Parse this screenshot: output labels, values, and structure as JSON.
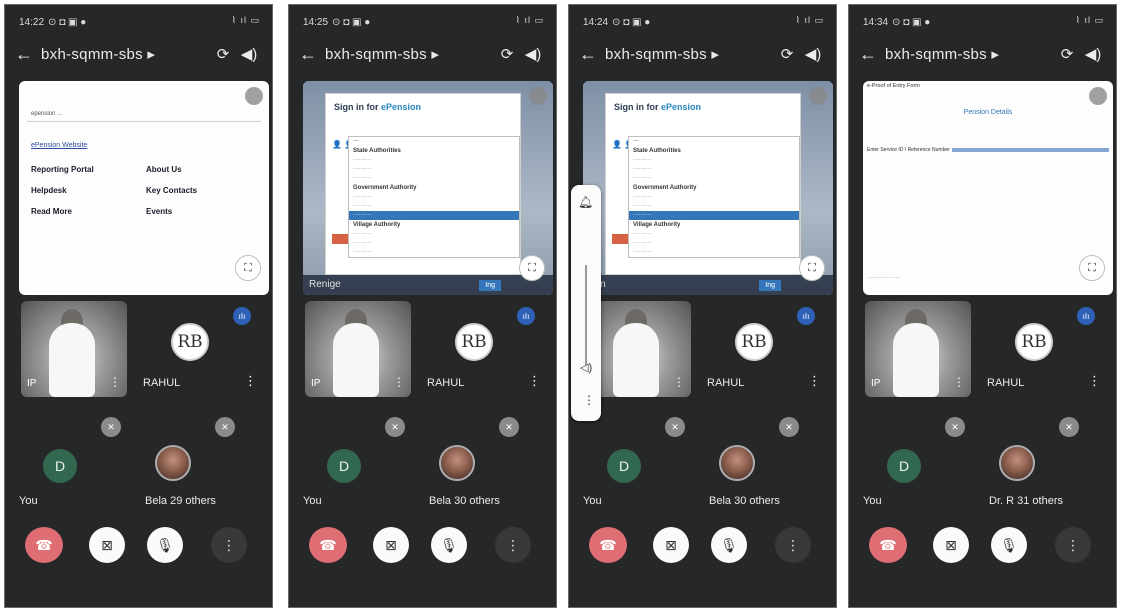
{
  "panels": [
    {
      "time": "14:22",
      "title": "bxh-sqmm-sbs",
      "presentation": "search",
      "search": {
        "query": "epension ... ",
        "result_link": "ePension Website",
        "left_sections": [
          "Reporting Portal",
          "Helpdesk",
          "Read More"
        ],
        "right_sections": [
          "About Us",
          "Key Contacts",
          "Events"
        ]
      },
      "tile1_name": "IP",
      "tile2_name": "RAHUL",
      "rb_initials": "RB",
      "you_initial": "D",
      "you_label": "You",
      "other_label": "Bela  29 others"
    },
    {
      "time": "14:25",
      "title": "bxh-sqmm-sbs",
      "presentation": "signin",
      "signin": {
        "title_pre": "Sign in for ",
        "title_brand": "ePension",
        "groups": [
          "State Authorities",
          "Government Authority",
          "Village Authority"
        ],
        "login_bar_text": "Renige",
        "login_btn": "Ing"
      },
      "tile1_name": "IP",
      "tile2_name": "RAHUL",
      "rb_initials": "RB",
      "you_initial": "D",
      "you_label": "You",
      "other_label": "Bela  30 others"
    },
    {
      "time": "14:24",
      "title": "bxh-sqmm-sbs",
      "presentation": "signin",
      "signin": {
        "title_pre": "Sign in for ",
        "title_brand": "ePension",
        "groups": [
          "State Authorities",
          "Government Authority",
          "Village Authority"
        ],
        "login_bar_text": "gan",
        "login_btn": "Ing"
      },
      "volume_overlay": true,
      "tile1_name": "IP",
      "tile2_name": "RAHUL",
      "rb_initials": "RB",
      "you_initial": "D",
      "you_label": "You",
      "other_label": "Bela  30 others"
    },
    {
      "time": "14:34",
      "title": "bxh-sqmm-sbs",
      "presentation": "entry",
      "entry": {
        "page_title": "e-Proof of Entry Form",
        "heading": "Pension Details",
        "row_label": "Enter Service ID / Reference Number"
      },
      "tile1_name": "IP",
      "tile2_name": "RAHUL",
      "rb_initials": "RB",
      "you_initial": "D",
      "you_label": "You",
      "other_label": "Dr. R  31 others"
    }
  ],
  "icons": {
    "back": "arrow-left",
    "switch_camera": "camera-switch",
    "speaker": "volume",
    "end_call": "phone-hangup",
    "camera_off": "video-off",
    "mic_off": "mic-off",
    "more": "more-vertical"
  },
  "colors": {
    "end_call": "#e86a72",
    "speaker_badge": "#2c63c5",
    "avatar_d": "#2e6b4f",
    "brand_blue": "#1e88c7"
  }
}
